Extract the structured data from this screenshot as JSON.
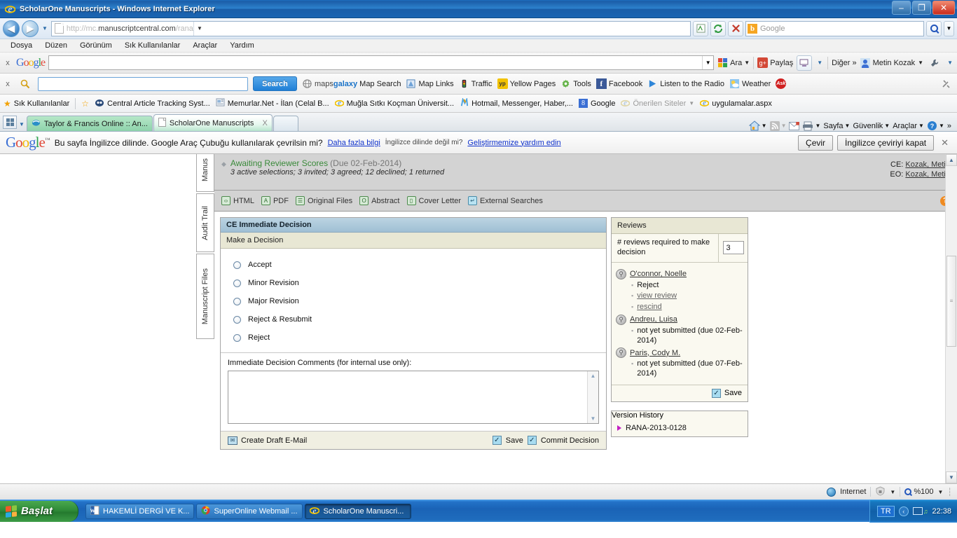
{
  "window": {
    "title": "ScholarOne Manuscripts - Windows Internet Explorer",
    "minimize": "–",
    "maximize": "❐",
    "close": "✕"
  },
  "address_bar": {
    "url_prefix": "http://mc.",
    "url_domain": "manuscriptcentral.com",
    "url_path": "/rana",
    "refresh_icon": "refresh-icon",
    "stop_icon": "stop-icon",
    "compat_icon": "compatibility-view-icon",
    "search_placeholder": "Google",
    "search_engine_icon": "bing-icon",
    "back": "◀",
    "forward": "▶"
  },
  "menu": {
    "items": [
      "Dosya",
      "Düzen",
      "Görünüm",
      "Sık Kullanılanlar",
      "Araçlar",
      "Yardım"
    ]
  },
  "google_toolbar": {
    "close": "x",
    "logo": [
      "G",
      "o",
      "o",
      "g",
      "l",
      "e"
    ],
    "search_value": "",
    "buttons": [
      {
        "label": "Ara",
        "icon": "google-search-icon"
      },
      {
        "label": "Paylaş",
        "icon": "google-plus-share-icon"
      },
      {
        "label": "",
        "icon": "screen-icon"
      },
      {
        "label": "Diğer »",
        "icon": "more-icon"
      }
    ],
    "user": "Metin Kozak",
    "wrench_icon": "wrench-icon"
  },
  "ask_toolbar": {
    "close": "x",
    "search_value": "",
    "search_button": "Search",
    "items": [
      {
        "label": "Map Search",
        "brand": "mapsgalaxy",
        "icon": "globe-icon"
      },
      {
        "label": "Map Links",
        "icon": "map-links-icon"
      },
      {
        "label": "Traffic",
        "icon": "traffic-light-icon"
      },
      {
        "label": "Yellow Pages",
        "icon": "yellow-pages-icon"
      },
      {
        "label": "Tools",
        "icon": "gear-icon"
      },
      {
        "label": "Facebook",
        "icon": "facebook-icon"
      },
      {
        "label": "Listen to the Radio",
        "icon": "play-icon"
      },
      {
        "label": "Weather",
        "icon": "weather-sun-icon"
      },
      {
        "label": "",
        "icon": "ask-icon"
      }
    ],
    "settings_icon": "tools-icon"
  },
  "favorites_bar": {
    "title": "Sık Kullanılanlar",
    "items": [
      {
        "label": "Central Article Tracking Syst...",
        "icon": "cats-icon"
      },
      {
        "label": "Memurlar.Net - İlan (Celal B...",
        "icon": "news-icon"
      },
      {
        "label": "Muğla Sıtkı Koçman Üniversit...",
        "icon": "ie-icon"
      },
      {
        "label": "Hotmail, Messenger, Haber,...",
        "icon": "msn-icon"
      },
      {
        "label": "Google",
        "icon": "google-blue-icon"
      },
      {
        "label": "Önerilen Siteler",
        "icon": "ie-icon",
        "dim": true
      },
      {
        "label": "uygulamalar.aspx",
        "icon": "ie-icon"
      }
    ]
  },
  "tabs": [
    {
      "label": "Taylor & Francis Online :: An...",
      "active": false,
      "icon": "tf-icon"
    },
    {
      "label": "ScholarOne Manuscripts",
      "active": true,
      "icon": "page-icon",
      "close": "X"
    }
  ],
  "command_bar": {
    "items": [
      {
        "label": "",
        "icon": "home-icon",
        "caret": true
      },
      {
        "label": "",
        "icon": "rss-icon",
        "caret": true
      },
      {
        "label": "",
        "icon": "mail-icon"
      },
      {
        "label": "",
        "icon": "print-icon",
        "caret": true
      },
      {
        "label": "Sayfa",
        "icon": "",
        "caret": true
      },
      {
        "label": "Güvenlik",
        "icon": "",
        "caret": true
      },
      {
        "label": "Araçlar",
        "icon": "",
        "caret": true
      },
      {
        "label": "",
        "icon": "help-icon",
        "caret": true
      }
    ],
    "overflow": "»"
  },
  "translate_bar": {
    "logo": [
      "G",
      "o",
      "o",
      "g",
      "l",
      "e"
    ],
    "message": "Bu sayfa İngilizce dilinde. Google Araç Çubuğu kullanılarak çevrilsin mi?",
    "more_link": "Daha fazla bilgi",
    "not_english": "İngilizce dilinde değil mi?",
    "help_link": "Geliştirmemize yardım edin",
    "translate_button": "Çevir",
    "turn_off_button": "İngilizce çeviriyi kapat",
    "close": "✕"
  },
  "side_tabs": [
    {
      "label": "Manus"
    },
    {
      "label": "Audit Trail"
    },
    {
      "label": "Manuscript Files"
    }
  ],
  "status_band": {
    "bullet": "◆",
    "title": "Awaiting Reviewer Scores",
    "due": "(Due 02-Feb-2014)",
    "detail": "3 active selections; 3 invited; 3 agreed; 12 declined; 1 returned",
    "ce_label": "CE:",
    "ce_value": "Kozak, Metin",
    "eo_label": "EO:",
    "eo_value": "Kozak, Metin"
  },
  "files_row": {
    "items": [
      {
        "label": "HTML",
        "icon": "html-icon",
        "glyph": "‹›"
      },
      {
        "label": "PDF",
        "icon": "pdf-icon",
        "glyph": "A"
      },
      {
        "label": "Original Files",
        "icon": "original-files-icon",
        "glyph": "☰"
      },
      {
        "label": "Abstract",
        "icon": "abstract-icon",
        "glyph": "O"
      },
      {
        "label": "Cover Letter",
        "icon": "cover-letter-icon",
        "glyph": "▯"
      },
      {
        "label": "External Searches",
        "icon": "external-searches-icon",
        "glyph": "↵"
      }
    ],
    "help_icon": "help-icon",
    "help_glyph": "?"
  },
  "decision_panel": {
    "title": "CE Immediate Decision",
    "subtitle": "Make a Decision",
    "options": [
      {
        "label": "Accept",
        "selected": false
      },
      {
        "label": "Minor Revision",
        "selected": false
      },
      {
        "label": "Major Revision",
        "selected": false
      },
      {
        "label": "Reject & Resubmit",
        "selected": false
      },
      {
        "label": "Reject",
        "selected": false
      }
    ],
    "comments_label": "Immediate Decision Comments (for internal use only):",
    "comments_value": "",
    "actions": {
      "draft_email": "Create Draft E-Mail",
      "draft_email_icon": "envelope-icon",
      "save": "Save",
      "commit": "Commit Decision"
    }
  },
  "reviews_panel": {
    "title": "Reviews",
    "required_label": "# reviews required to make decision",
    "required_value": "3",
    "reviewers": [
      {
        "name": "O'connor, Noelle",
        "icon": "reviewer-icon",
        "lines": [
          {
            "text": "Reject",
            "link": false
          },
          {
            "text": "view review",
            "link": true
          },
          {
            "text": "rescind",
            "link": true
          }
        ]
      },
      {
        "name": "Andreu, Luisa",
        "icon": "reviewer-icon",
        "lines": [
          {
            "text": "not yet submitted (due 02-Feb-2014)",
            "link": false
          }
        ]
      },
      {
        "name": "Paris, Cody M.",
        "icon": "reviewer-icon",
        "lines": [
          {
            "text": "not yet submitted (due 07-Feb-2014)",
            "link": false
          }
        ]
      }
    ],
    "save": "Save"
  },
  "version_history": {
    "title": "Version History",
    "entries": [
      {
        "label": "RANA-2013-0128"
      }
    ]
  },
  "ie_status_bar": {
    "zone": "Internet",
    "zone_icon": "globe-icon",
    "protected_icon": "protected-mode-icon",
    "zoom": "%100"
  },
  "taskbar": {
    "start": "Başlat",
    "items": [
      {
        "label": "HAKEMLİ DERGİ VE K...",
        "icon": "word-icon",
        "active": false
      },
      {
        "label": "SuperOnline Webmail ...",
        "icon": "chrome-icon",
        "active": false
      },
      {
        "label": "ScholarOne Manuscri...",
        "icon": "ie-icon",
        "active": true
      }
    ],
    "tray": {
      "language": "TR",
      "chevron": "‹",
      "volume_icon": "volume-icon",
      "time": "22:38"
    }
  },
  "colors": {
    "accent": "#1a63b6",
    "panel_header": "#9fbfd4",
    "panel_sub": "#e8e7d4",
    "green_status": "#3a8a3a",
    "link": "#1133cc"
  }
}
